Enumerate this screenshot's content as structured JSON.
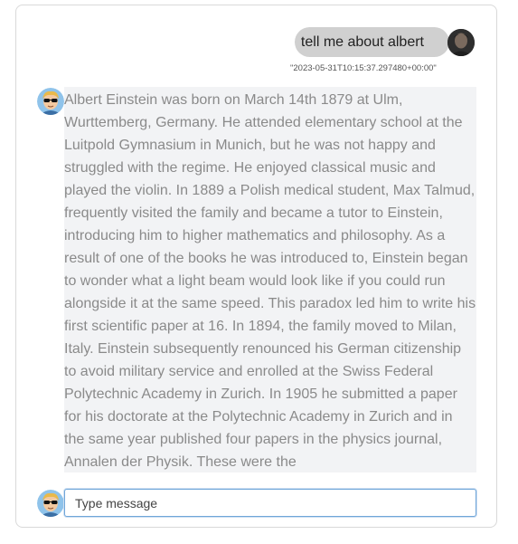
{
  "conversation": {
    "user_message": {
      "text": "tell me about albert",
      "timestamp": "\"2023-05-31T10:15:37.297480+00:00\""
    },
    "bot_message": {
      "text": "Albert Einstein was born on March 14th 1879 at Ulm, Wurttemberg, Germany. He attended elementary school at the Luitpold Gymnasium in Munich, but he was not happy and struggled with the regime. He enjoyed classical music and played the violin. In 1889 a Polish medical student, Max Talmud, frequently visited the family and became a tutor to Einstein, introducing him to higher mathematics and philosophy. As a result of one of the books he was introduced to, Einstein began to wonder what a light beam would look like if you could run alongside it at the same speed. This paradox led him to write his first scientific paper at 16. In 1894, the family moved to Milan, Italy. Einstein subsequently renounced his German citizenship to avoid military service and enrolled at the Swiss Federal Polytechnic Academy in Zurich. In 1905 he submitted a paper for his doctorate at the Polytechnic Academy in Zurich and in the same year published four papers in the physics journal, Annalen der Physik. These were the"
    }
  },
  "composer": {
    "placeholder": "Type message",
    "value": ""
  },
  "colors": {
    "user_bubble": "#d0d0d0",
    "bot_bubble": "#f2f3f5",
    "input_focus_border": "#6fa6d9"
  },
  "icons": {
    "user_avatar": "user-photo-avatar",
    "bot_avatar": "cartoon-sunglasses-avatar"
  }
}
